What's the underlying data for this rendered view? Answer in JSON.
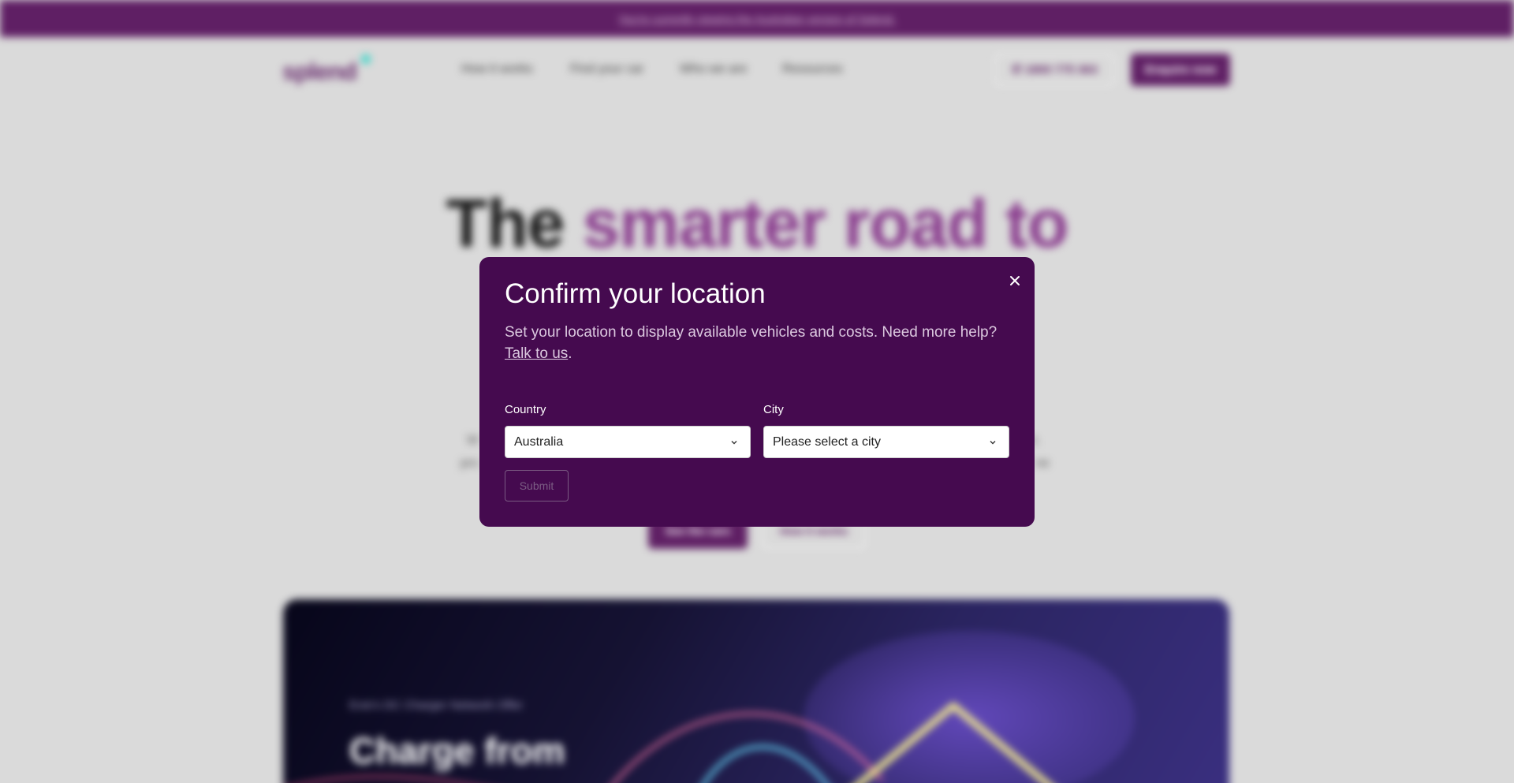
{
  "banner": {
    "text": "You're currently viewing the Australian version of Splend."
  },
  "nav": {
    "logo": "splend",
    "links": [
      "How it works",
      "Find your car",
      "Who we are",
      "Resources"
    ],
    "phone": "1800 775 363",
    "cta": "Enquire now"
  },
  "hero": {
    "title_dark": "The",
    "title_purple": "smarter road to",
    "side_left_1": "W",
    "side_left_2": "pro",
    "side_right_1": "n.",
    "side_right_2": "ne",
    "primary_button": "See the cars",
    "secondary_button": "How it works"
  },
  "promo": {
    "subtitle": "Evie's DC Charger Network Offer",
    "title": "Charge from"
  },
  "modal": {
    "title": "Confirm your location",
    "description": "Set your location to display available vehicles and costs. Need more help? ",
    "link_text": "Talk to us",
    "description_end": ".",
    "country_label": "Country",
    "country_value": "Australia",
    "city_label": "City",
    "city_placeholder": "Please select a city",
    "submit": "Submit"
  },
  "colors": {
    "brand_purple": "#5f1f64",
    "modal_bg": "#450a4f",
    "accent_teal": "#3fd6c9"
  }
}
